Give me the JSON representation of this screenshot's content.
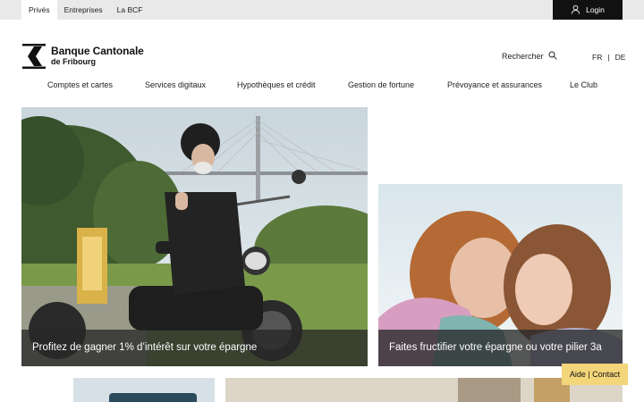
{
  "topbar": {
    "tabs": [
      {
        "label": "Privés",
        "active": true
      },
      {
        "label": "Entreprises",
        "active": false
      },
      {
        "label": "La BCF",
        "active": false
      }
    ],
    "login_label": "Login"
  },
  "header": {
    "logo_line1": "Banque Cantonale",
    "logo_line2": "de Fribourg",
    "search_label": "Rechercher",
    "lang": {
      "fr": "FR",
      "sep": "|",
      "de": "DE"
    }
  },
  "nav": {
    "items": [
      "Comptes et cartes",
      "Services digitaux",
      "Hypothèques et crédit",
      "Gestion de fortune",
      "Prévoyance et assurances",
      "Le Club"
    ]
  },
  "cards": [
    {
      "caption": "Profitez de gagner 1% d’intérêt sur votre épargne"
    },
    {
      "caption": "Faites fructifier votre épargne ou votre pilier 3a"
    }
  ],
  "help": {
    "label": "Aide | Contact"
  },
  "colors": {
    "accent": "#f3d57a",
    "dark": "#111111",
    "topbar": "#e9e9e9"
  }
}
